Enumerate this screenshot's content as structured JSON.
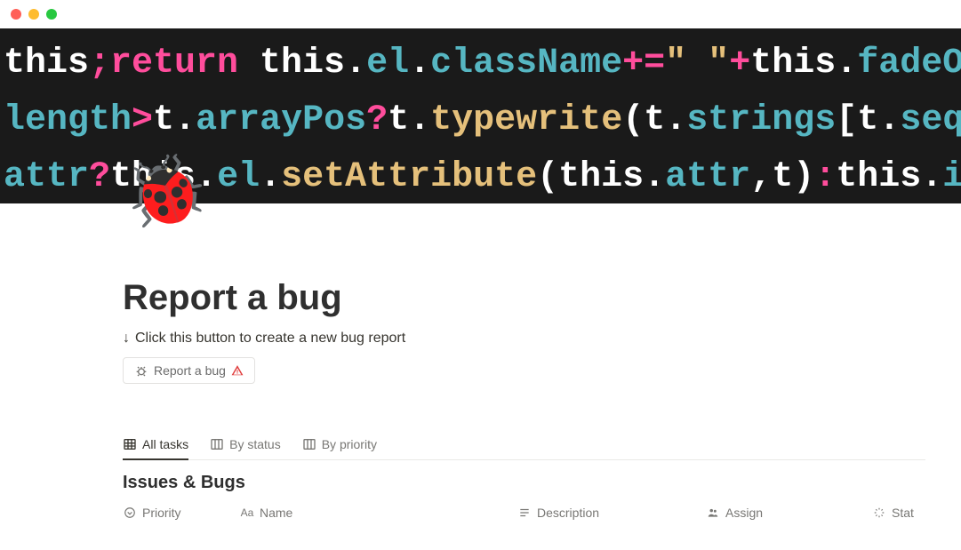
{
  "page": {
    "icon": "🐞",
    "title": "Report a bug",
    "hint_arrow": "↓",
    "hint_text": "Click this button to create a new bug report"
  },
  "button": {
    "label": "Report a bug"
  },
  "tabs": [
    {
      "label": "All tasks"
    },
    {
      "label": "By status"
    },
    {
      "label": "By priority"
    }
  ],
  "section": {
    "title": "Issues & Bugs"
  },
  "columns": [
    {
      "label": "Priority"
    },
    {
      "label": "Name"
    },
    {
      "label": "Description"
    },
    {
      "label": "Assign"
    },
    {
      "label": "Stat"
    }
  ]
}
